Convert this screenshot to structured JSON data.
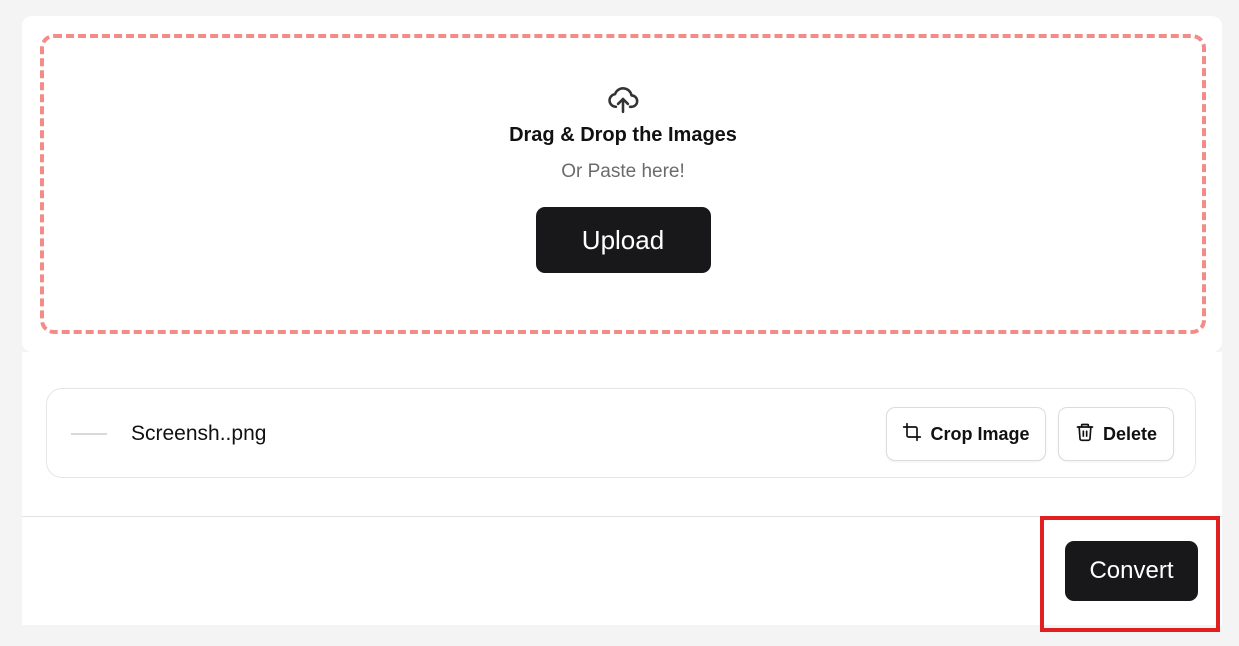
{
  "dropzone": {
    "icon": "cloud-upload-icon",
    "title": "Drag & Drop the Images",
    "subtitle": "Or Paste here!",
    "upload_label": "Upload",
    "border_color": "#f38b86"
  },
  "files": [
    {
      "name": "Screensh..png",
      "crop_label": "Crop Image",
      "crop_icon": "crop-icon",
      "delete_label": "Delete",
      "delete_icon": "trash-icon"
    }
  ],
  "footer": {
    "convert_label": "Convert"
  },
  "colors": {
    "button_dark": "#18181b",
    "highlight": "#e02020"
  }
}
